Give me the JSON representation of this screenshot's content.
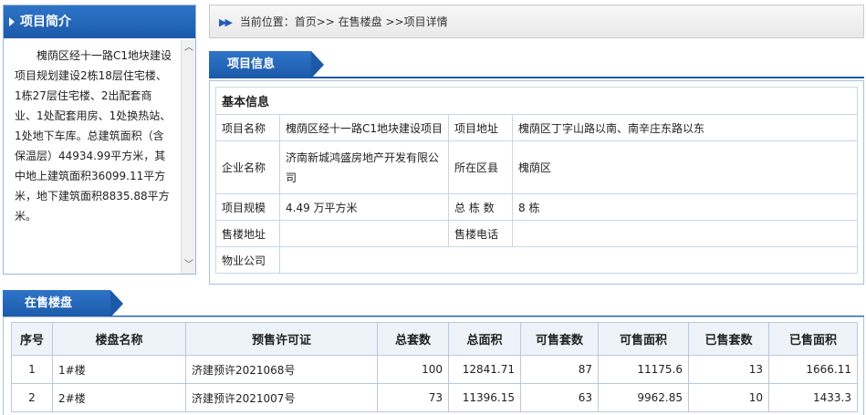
{
  "intro": {
    "title": "项目简介",
    "text": "槐荫区经十一路C1地块建设项目规划建设2栋18层住宅楼、1栋27层住宅楼、2出配套商业、1处配套用房、1处换热站、1处地下车库。总建筑面积（含保温层）44934.99平方米，其中地上建筑面积36099.11平方米，地下建筑面积8835.88平方米。"
  },
  "breadcrumb": {
    "text": "当前位置：首页>> 在售楼盘 >>项目详情"
  },
  "project_info": {
    "tab": "项目信息",
    "section_title": "基本信息",
    "rows": {
      "name_label": "项目名称",
      "name": "槐荫区经十一路C1地块建设项目",
      "address_label": "项目地址",
      "address": "槐荫区丁字山路以南、南辛庄东路以东",
      "company_label": "企业名称",
      "company": "济南新城鸿盛房地产开发有限公司",
      "district_label": "所在区县",
      "district": "槐荫区",
      "scale_label": "项目规模",
      "scale": "4.49 万平方米",
      "buildings_label": "总 栋 数",
      "buildings": "8 栋",
      "sales_addr_label": "售楼地址",
      "sales_addr": "",
      "sales_phone_label": "售楼电话",
      "sales_phone": "",
      "property_label": "物业公司",
      "property": ""
    }
  },
  "sales": {
    "tab": "在售楼盘",
    "headers": [
      "序号",
      "楼盘名称",
      "预售许可证",
      "总套数",
      "总面积",
      "可售套数",
      "可售面积",
      "已售套数",
      "已售面积"
    ],
    "rows": [
      {
        "no": "1",
        "name": "1#楼",
        "permit": "济建预许2021068号",
        "total_units": "100",
        "total_area": "12841.71",
        "avail_units": "87",
        "avail_area": "11175.6",
        "sold_units": "13",
        "sold_area": "1666.11"
      },
      {
        "no": "2",
        "name": "2#楼",
        "permit": "济建预许2021007号",
        "total_units": "73",
        "total_area": "11396.15",
        "avail_units": "63",
        "avail_area": "9962.85",
        "sold_units": "10",
        "sold_area": "1433.3"
      }
    ]
  },
  "colors": {
    "accent": "#1c5aa9",
    "border": "#a9c1dd"
  }
}
